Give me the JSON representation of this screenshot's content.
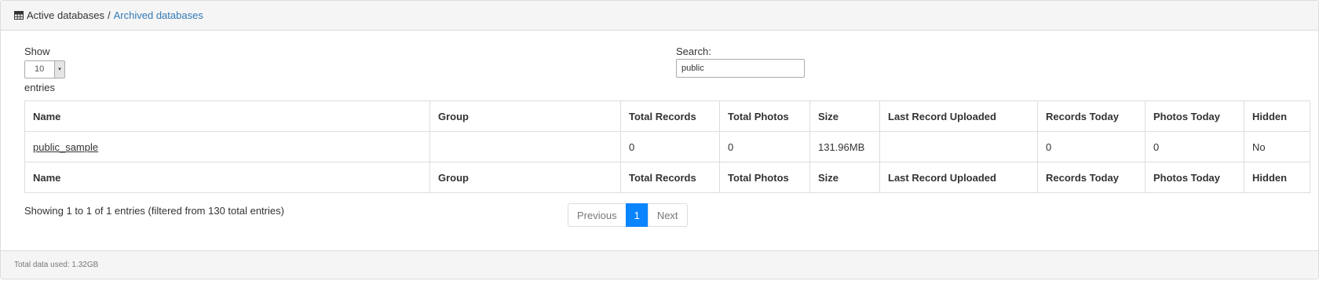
{
  "header": {
    "active_label": "Active databases",
    "separator": "/",
    "archived_label": "Archived databases"
  },
  "length": {
    "show_label": "Show",
    "selected_value": "10",
    "entries_label": "entries"
  },
  "search": {
    "label": "Search:",
    "value": "public"
  },
  "table": {
    "columns": [
      "Name",
      "Group",
      "Total Records",
      "Total Photos",
      "Size",
      "Last Record Uploaded",
      "Records Today",
      "Photos Today",
      "Hidden"
    ],
    "rows": [
      {
        "name": "public_sample",
        "group": "",
        "total_records": "0",
        "total_photos": "0",
        "size": "131.96MB",
        "last_record_uploaded": "",
        "records_today": "0",
        "photos_today": "0",
        "hidden": "No"
      }
    ]
  },
  "info_text": "Showing 1 to 1 of 1 entries (filtered from 130 total entries)",
  "pagination": {
    "previous": "Previous",
    "current_page": "1",
    "next": "Next"
  },
  "footer": {
    "total_data": "Total data used: 1.32GB"
  },
  "colors": {
    "link": "#337ab7",
    "active_page": "#0a84ff",
    "panel_bg": "#f5f5f5",
    "border": "#dddddd"
  }
}
